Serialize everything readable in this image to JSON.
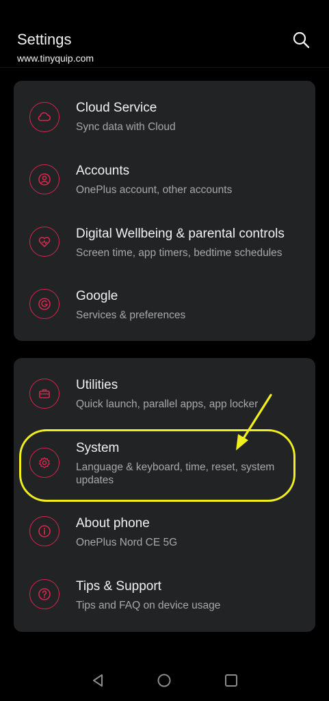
{
  "header": {
    "title": "Settings",
    "watermark": "www.tinyquip.com"
  },
  "colors": {
    "accent": "#d8264e",
    "card_bg": "#222325",
    "highlight": "#f2ef1f"
  },
  "sections": [
    {
      "items": [
        {
          "title": "Cloud Service",
          "subtitle": "Sync data with Cloud",
          "icon": "cloud-icon"
        },
        {
          "title": "Accounts",
          "subtitle": "OnePlus account, other accounts",
          "icon": "account-icon"
        },
        {
          "title": "Digital Wellbeing & parental controls",
          "subtitle": "Screen time, app timers, bedtime schedules",
          "icon": "heart-icon"
        },
        {
          "title": "Google",
          "subtitle": "Services & preferences",
          "icon": "google-icon"
        }
      ]
    },
    {
      "items": [
        {
          "title": "Utilities",
          "subtitle": "Quick launch, parallel apps, app locker",
          "icon": "toolbox-icon"
        },
        {
          "title": "System",
          "subtitle": "Language & keyboard, time, reset, system updates",
          "icon": "gear-icon"
        },
        {
          "title": "About phone",
          "subtitle": "OnePlus Nord CE 5G",
          "icon": "info-icon"
        },
        {
          "title": "Tips & Support",
          "subtitle": "Tips and FAQ on device usage",
          "icon": "help-icon"
        }
      ]
    }
  ],
  "navbar": {
    "buttons": [
      "back-icon",
      "home-icon",
      "recents-icon"
    ]
  }
}
